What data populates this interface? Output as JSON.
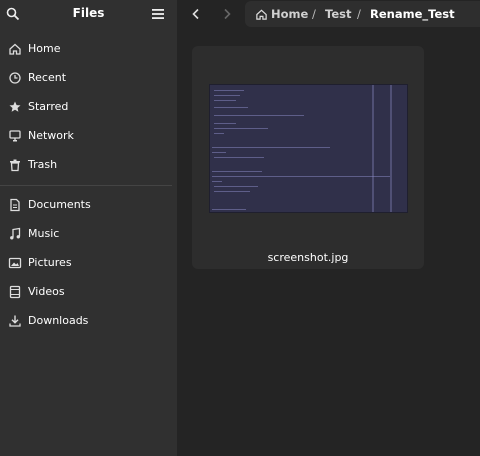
{
  "window": {
    "title": "Files"
  },
  "sidebar": {
    "places": [
      {
        "label": "Home",
        "icon": "home-icon"
      },
      {
        "label": "Recent",
        "icon": "clock-icon"
      },
      {
        "label": "Starred",
        "icon": "star-icon"
      },
      {
        "label": "Network",
        "icon": "network-icon"
      },
      {
        "label": "Trash",
        "icon": "trash-icon"
      }
    ],
    "bookmarks": [
      {
        "label": "Documents",
        "icon": "document-icon"
      },
      {
        "label": "Music",
        "icon": "music-icon"
      },
      {
        "label": "Pictures",
        "icon": "picture-icon"
      },
      {
        "label": "Videos",
        "icon": "video-icon"
      },
      {
        "label": "Downloads",
        "icon": "download-icon"
      }
    ]
  },
  "path": {
    "home": "Home",
    "sep": "/",
    "folder": "Test",
    "current": "Rename_Test"
  },
  "files": [
    {
      "name": "screenshot.jpg",
      "type": "image"
    }
  ],
  "colors": {
    "sidebar_bg": "#303030",
    "content_bg": "#242424",
    "tile_bg": "#2d2d2d",
    "text": "#ffffff"
  }
}
